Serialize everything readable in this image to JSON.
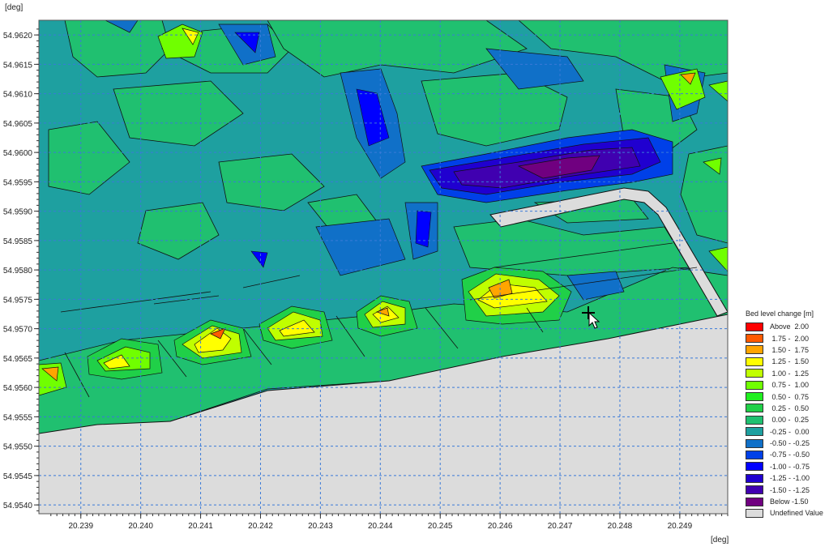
{
  "chart_data": {
    "type": "contour",
    "title": "",
    "xlabel": "[deg]",
    "ylabel": "[deg]",
    "xlim": [
      20.2383,
      20.2498
    ],
    "ylim": [
      54.95385,
      54.96225
    ],
    "x_ticks": [
      "20.239",
      "20.240",
      "20.241",
      "20.242",
      "20.243",
      "20.244",
      "20.245",
      "20.246",
      "20.247",
      "20.248",
      "20.249"
    ],
    "y_ticks": [
      "54.9620",
      "54.9615",
      "54.9610",
      "54.9605",
      "54.9600",
      "54.9595",
      "54.9590",
      "54.9585",
      "54.9580",
      "54.9575",
      "54.9570",
      "54.9565",
      "54.9560",
      "54.9555",
      "54.9550",
      "54.9545",
      "54.9540"
    ],
    "grid": true,
    "legend": {
      "title": "Bed level change [m]",
      "placement": "right",
      "classes": [
        {
          "label": "Above  2.00",
          "color": "#ff0000"
        },
        {
          "label": " 1.75 -  2.00",
          "color": "#ff5a00"
        },
        {
          "label": " 1.50 -  1.75",
          "color": "#ffa500"
        },
        {
          "label": " 1.25 -  1.50",
          "color": "#ffff00"
        },
        {
          "label": " 1.00 -  1.25",
          "color": "#c0ff00"
        },
        {
          "label": " 0.75 -  1.00",
          "color": "#70ff00"
        },
        {
          "label": " 0.50 -  0.75",
          "color": "#20f020"
        },
        {
          "label": " 0.25 -  0.50",
          "color": "#20d048"
        },
        {
          "label": " 0.00 -  0.25",
          "color": "#20c070"
        },
        {
          "label": "-0.25 -  0.00",
          "color": "#1ea0a0"
        },
        {
          "label": "-0.50 - -0.25",
          "color": "#1070c8"
        },
        {
          "label": "-0.75 - -0.50",
          "color": "#0040e8"
        },
        {
          "label": "-1.00 - -0.75",
          "color": "#0000ff"
        },
        {
          "label": "-1.25 - -1.00",
          "color": "#2000d0"
        },
        {
          "label": "-1.50 - -1.25",
          "color": "#4000b0"
        },
        {
          "label": "Below -1.50",
          "color": "#700080"
        },
        {
          "label": "Undefined Value",
          "color": "#dcdcdc"
        }
      ]
    }
  }
}
